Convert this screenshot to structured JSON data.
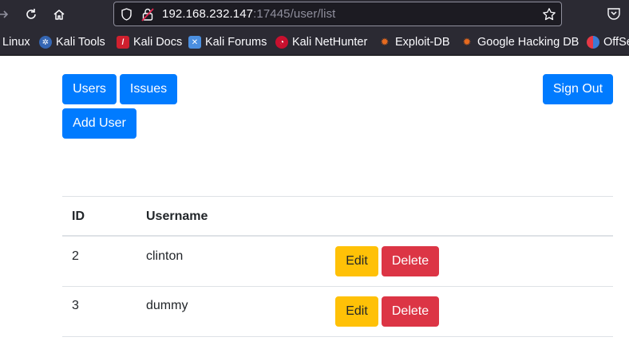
{
  "browser": {
    "url_host": "192.168.232.147",
    "url_rest": ":17445/user/list",
    "bookmarks": [
      {
        "label": "Linux",
        "icon": "kali-linux-icon"
      },
      {
        "label": "Kali Tools",
        "icon": "kali-tools-icon"
      },
      {
        "label": "Kali Docs",
        "icon": "kali-docs-icon"
      },
      {
        "label": "Kali Forums",
        "icon": "kali-forums-icon"
      },
      {
        "label": "Kali NetHunter",
        "icon": "kali-nethunter-icon"
      },
      {
        "label": "Exploit-DB",
        "icon": "exploit-db-icon"
      },
      {
        "label": "Google Hacking DB",
        "icon": "google-hacking-db-icon"
      },
      {
        "label": "OffSe",
        "icon": "offsec-icon"
      }
    ]
  },
  "nav": {
    "users_label": "Users",
    "issues_label": "Issues",
    "signout_label": "Sign Out",
    "add_user_label": "Add User"
  },
  "table": {
    "headers": {
      "id": "ID",
      "username": "Username"
    },
    "rows": [
      {
        "id": "2",
        "username": "clinton",
        "edit": "Edit",
        "delete": "Delete"
      },
      {
        "id": "3",
        "username": "dummy",
        "edit": "Edit",
        "delete": "Delete"
      }
    ]
  },
  "colors": {
    "primary": "#007bff",
    "warning": "#ffc107",
    "danger": "#dc3545",
    "chrome": "#2b2a33"
  }
}
